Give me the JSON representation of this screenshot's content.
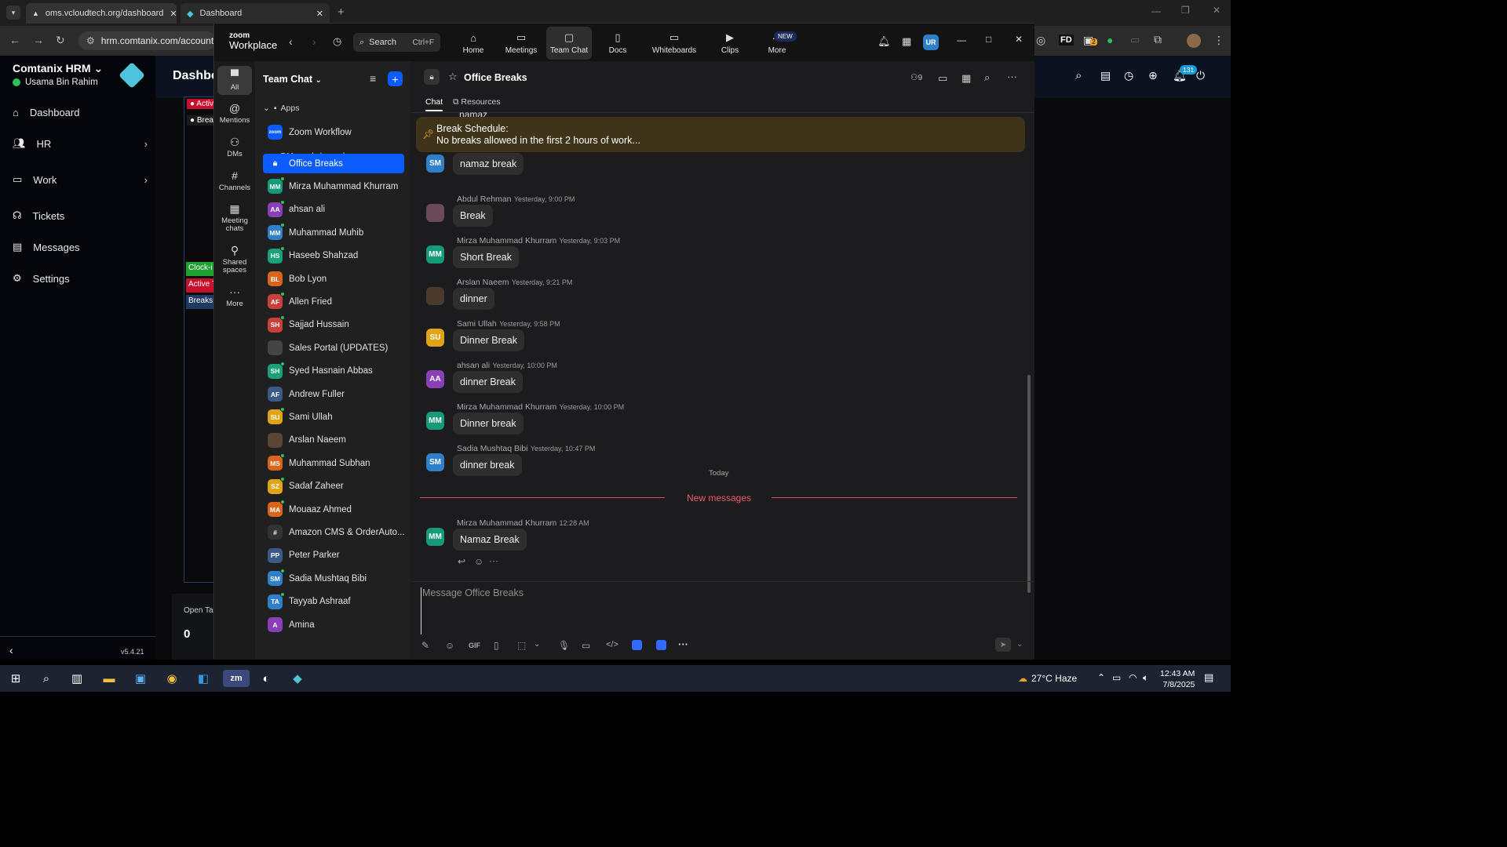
{
  "browser": {
    "tabs": [
      {
        "label": "oms.vcloudtech.org/dashboard"
      },
      {
        "label": "Dashboard"
      }
    ],
    "address": "hrm.comtanix.com/account/",
    "ext_badge": "2",
    "ext_label": "FD"
  },
  "hrm": {
    "brand": "Comtanix HRM",
    "user": "Usama Bin Rahim",
    "page_title": "Dashbo",
    "nav": [
      {
        "label": "Dashboard",
        "icon": "home-icon"
      },
      {
        "label": "HR",
        "icon": "users-icon"
      },
      {
        "label": "Work",
        "icon": "briefcase-icon"
      },
      {
        "label": "Tickets",
        "icon": "headset-icon"
      },
      {
        "label": "Messages",
        "icon": "message-icon"
      },
      {
        "label": "Settings",
        "icon": "gear-icon"
      }
    ],
    "version": "v5.4.21",
    "notif_count": "131",
    "legend": [
      "Activ",
      "Brea"
    ],
    "status_buttons": [
      "Clock-i",
      "Active T",
      "Breaks"
    ],
    "open_tasks_label": "Open Ta",
    "open_tasks_value": "0"
  },
  "zoom": {
    "logo_top": "zoom",
    "logo_bottom": "Workplace",
    "search_label": "Search",
    "search_shortcut": "Ctrl+F",
    "tabs": [
      "Home",
      "Meetings",
      "Team Chat",
      "Docs",
      "Whiteboards",
      "Clips",
      "More"
    ],
    "new_badge": "NEW",
    "user_avatar": "UR",
    "rail": [
      {
        "label": "All"
      },
      {
        "label": "Mentions"
      },
      {
        "label": "DMs"
      },
      {
        "label": "Channels"
      },
      {
        "label": "Meeting chats"
      },
      {
        "label": "Shared spaces"
      },
      {
        "label": "More"
      }
    ],
    "list_title": "Team Chat",
    "sections": {
      "apps": "Apps",
      "dms": "DMs and channels"
    },
    "apps": [
      {
        "label": "Zoom Workflow",
        "initials": "zoom"
      }
    ],
    "items": [
      {
        "label": "Office Breaks",
        "initials": "",
        "color": "#0b5cff"
      },
      {
        "label": "Mirza Muhammad Khurram",
        "initials": "MM",
        "color": "#159a7a"
      },
      {
        "label": "ahsan ali",
        "initials": "AA",
        "color": "#8a3fb8"
      },
      {
        "label": "Muhammad Muhib",
        "initials": "MM",
        "color": "#2f7fc9"
      },
      {
        "label": "Haseeb Shahzad",
        "initials": "HS",
        "color": "#19a17a"
      },
      {
        "label": "Bob Lyon",
        "initials": "BL",
        "color": "#d9641b"
      },
      {
        "label": "Allen Fried",
        "initials": "AF",
        "color": "#c8403a"
      },
      {
        "label": "Sajjad Hussain",
        "initials": "SH",
        "color": "#c8403a"
      },
      {
        "label": "Sales Portal (UPDATES)",
        "initials": "",
        "color": "#444444"
      },
      {
        "label": "Syed Hasnain Abbas",
        "initials": "SH",
        "color": "#19a17a"
      },
      {
        "label": "Andrew Fuller",
        "initials": "AF",
        "color": "#3b5b86"
      },
      {
        "label": "Sami Ullah",
        "initials": "SU",
        "color": "#e0a419"
      },
      {
        "label": "Arslan Naeem",
        "initials": "",
        "color": "#5a4636"
      },
      {
        "label": "Muhammad Subhan",
        "initials": "MS",
        "color": "#d9641b"
      },
      {
        "label": "Sadaf Zaheer",
        "initials": "SZ",
        "color": "#e0a419"
      },
      {
        "label": "Mouaaz Ahmed",
        "initials": "MA",
        "color": "#d9641b"
      },
      {
        "label": "Amazon CMS & OrderAuto...",
        "initials": "#",
        "color": "#333333"
      },
      {
        "label": "Peter Parker",
        "initials": "PP",
        "color": "#3b5b86"
      },
      {
        "label": "Sadia Mushtaq Bibi",
        "initials": "SM",
        "color": "#2f7fc9"
      },
      {
        "label": "Tayyab Ashraaf",
        "initials": "TA",
        "color": "#2f7fc9"
      },
      {
        "label": "Amina",
        "initials": "A",
        "color": "#8a3fb8"
      }
    ],
    "channel": {
      "name": "Office Breaks",
      "members": "9",
      "tabs": [
        "Chat",
        "Resources"
      ],
      "pinned_title": "Break Schedule:",
      "pinned_text": "No breaks allowed in the first 2 hours of work...",
      "partial_top": "namaz",
      "messages": [
        {
          "name": "",
          "time": "",
          "text": "namaz break",
          "initials": "SM",
          "color": "#2f7fc9"
        },
        {
          "name": "Abdul Rehman",
          "time": "Yesterday, 9:00 PM",
          "text": "Break",
          "initials": "",
          "color": "#6a4a5a"
        },
        {
          "name": "Mirza Muhammad Khurram",
          "time": "Yesterday, 9:03 PM",
          "text": "Short Break",
          "initials": "MM",
          "color": "#159a7a"
        },
        {
          "name": "Arslan Naeem",
          "time": "Yesterday, 9:21 PM",
          "text": "dinner",
          "initials": "",
          "color": "#4a3a2e"
        },
        {
          "name": "Sami Ullah",
          "time": "Yesterday, 9:58 PM",
          "text": "Dinner Break",
          "initials": "SU",
          "color": "#e0a419"
        },
        {
          "name": "ahsan ali",
          "time": "Yesterday, 10:00 PM",
          "text": "dinner Break",
          "initials": "AA",
          "color": "#8a3fb8"
        },
        {
          "name": "Mirza Muhammad Khurram",
          "time": "Yesterday, 10:00 PM",
          "text": "Dinner break",
          "initials": "MM",
          "color": "#159a7a"
        },
        {
          "name": "Sadia Mushtaq Bibi",
          "time": "Yesterday, 10:47 PM",
          "text": "dinner break",
          "initials": "SM",
          "color": "#2f7fc9"
        }
      ],
      "today_label": "Today",
      "new_messages_label": "New messages",
      "latest": {
        "name": "Mirza Muhammad Khurram",
        "time": "12:28 AM",
        "text": "Namaz Break",
        "initials": "MM",
        "color": "#159a7a"
      },
      "composer_placeholder": "Message Office Breaks",
      "gif_label": "GIF"
    }
  },
  "taskbar": {
    "weather": "27°C  Haze",
    "time": "12:43 AM",
    "date": "7/8/2025"
  }
}
